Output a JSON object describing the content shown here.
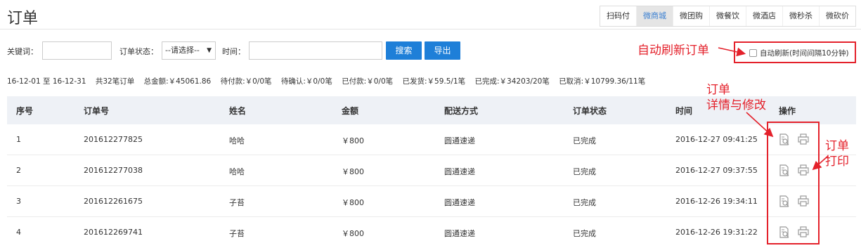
{
  "page": {
    "title": "订单"
  },
  "tabs": [
    "扫码付",
    "微商城",
    "微团购",
    "微餐饮",
    "微酒店",
    "微秒杀",
    "微砍价"
  ],
  "active_tab": 1,
  "filter": {
    "keyword_label": "关键词：",
    "status_label": "订单状态：",
    "status_value": "--请选择--",
    "time_label": "时间：",
    "search_label": "搜索",
    "export_label": "导出"
  },
  "auto_refresh": {
    "label": "自动刷新(时间间隔10分钟)",
    "checked": false
  },
  "annotations": {
    "refresh": "自动刷新订单",
    "detail_line1": "订单",
    "detail_line2": "详情与修改",
    "print_line1": "订单",
    "print_line2": "打印"
  },
  "summary": {
    "range": "16-12-01 至 16-12-31",
    "count": "共32笔订单",
    "total": "总金额:￥45061.86",
    "pending_pay": "待付款:￥0/0笔",
    "pending_confirm": "待确认:￥0/0笔",
    "paid": "已付款:￥0/0笔",
    "shipped": "已发货:￥59.5/1笔",
    "completed": "已完成:￥34203/20笔",
    "cancelled": "已取消:￥10799.36/11笔"
  },
  "table": {
    "headers": [
      "序号",
      "订单号",
      "姓名",
      "金额",
      "配送方式",
      "订单状态",
      "时间",
      "操作"
    ],
    "rows": [
      [
        "1",
        "201612277825",
        "哈哈",
        "￥800",
        "圆通速递",
        "已完成",
        "2016-12-27 09:41:25"
      ],
      [
        "2",
        "201612277038",
        "哈哈",
        "￥800",
        "圆通速递",
        "已完成",
        "2016-12-27 09:37:55"
      ],
      [
        "3",
        "201612261675",
        "子苔",
        "￥800",
        "圆通速递",
        "已完成",
        "2016-12-26 19:34:11"
      ],
      [
        "4",
        "201612269741",
        "子苔",
        "￥800",
        "圆通速递",
        "已完成",
        "2016-12-26 19:31:22"
      ]
    ]
  },
  "colors": {
    "accent": "#1e7fd8",
    "highlight": "#e4212b",
    "header_bg": "#eef1f6",
    "active_tab_text": "#3a7fd1"
  },
  "icons": {
    "detail": "document-search-icon",
    "print": "printer-icon"
  }
}
